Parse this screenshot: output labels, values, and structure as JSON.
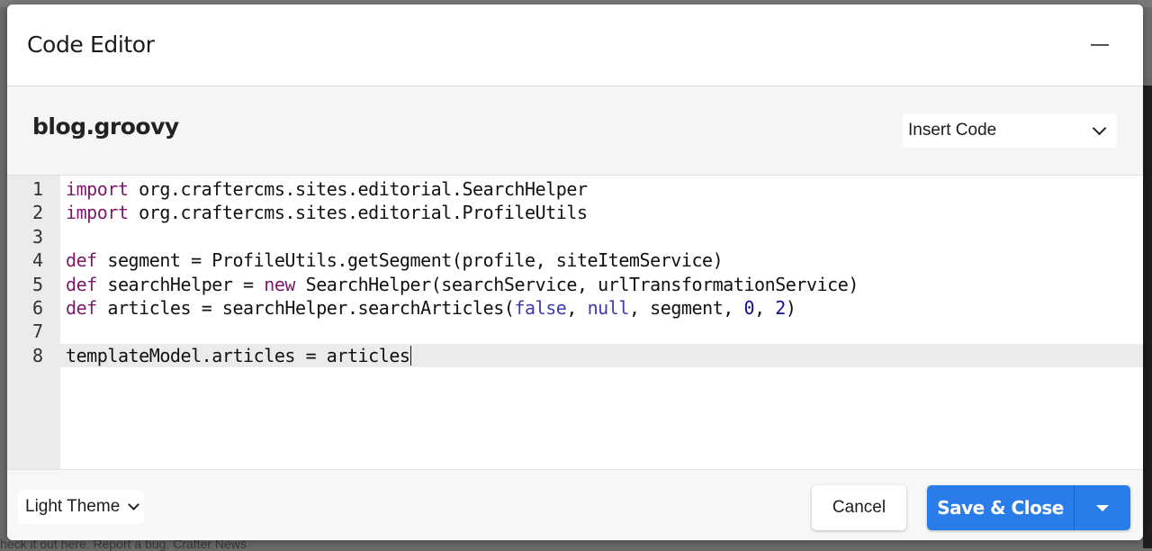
{
  "dialog": {
    "title": "Code Editor",
    "minimize_icon": "minimize-icon"
  },
  "subheader": {
    "file_name": "blog.groovy",
    "insert_code": {
      "selected": "Insert Code",
      "icon": "chevron-down-icon"
    }
  },
  "editor": {
    "language": "groovy",
    "active_line": 8,
    "lines": [
      {
        "number": "1",
        "tokens": [
          {
            "t": "import",
            "c": "kw"
          },
          {
            "t": " org.craftercms.sites.editorial.SearchHelper",
            "c": ""
          }
        ]
      },
      {
        "number": "2",
        "tokens": [
          {
            "t": "import",
            "c": "kw"
          },
          {
            "t": " org.craftercms.sites.editorial.ProfileUtils",
            "c": ""
          }
        ]
      },
      {
        "number": "3",
        "tokens": []
      },
      {
        "number": "4",
        "tokens": [
          {
            "t": "def",
            "c": "kw"
          },
          {
            "t": " segment = ProfileUtils.getSegment(profile, siteItemService)",
            "c": ""
          }
        ]
      },
      {
        "number": "5",
        "tokens": [
          {
            "t": "def",
            "c": "kw"
          },
          {
            "t": " searchHelper = ",
            "c": ""
          },
          {
            "t": "new",
            "c": "kw"
          },
          {
            "t": " SearchHelper(searchService, urlTransformationService)",
            "c": ""
          }
        ]
      },
      {
        "number": "6",
        "tokens": [
          {
            "t": "def",
            "c": "kw"
          },
          {
            "t": " articles = searchHelper.searchArticles(",
            "c": ""
          },
          {
            "t": "false",
            "c": "lit"
          },
          {
            "t": ", ",
            "c": ""
          },
          {
            "t": "null",
            "c": "lit"
          },
          {
            "t": ", segment, ",
            "c": ""
          },
          {
            "t": "0",
            "c": "num"
          },
          {
            "t": ", ",
            "c": ""
          },
          {
            "t": "2",
            "c": "num"
          },
          {
            "t": ")",
            "c": ""
          }
        ]
      },
      {
        "number": "7",
        "tokens": []
      },
      {
        "number": "8",
        "tokens": [
          {
            "t": "templateModel.articles = articles",
            "c": ""
          }
        ]
      }
    ]
  },
  "footer": {
    "theme_select": {
      "selected": "Light Theme",
      "icon": "chevron-down-icon"
    },
    "cancel_label": "Cancel",
    "save_label": "Save & Close",
    "save_menu_icon": "caret-down-icon"
  },
  "background": {
    "footer_links_text": "heck it out here. Report a bug. Crafter News"
  },
  "colors": {
    "primary": "#2a7de8",
    "keyword": "#7a1a6a",
    "literal": "#3a3db0",
    "number": "#11118c",
    "active_line": "#ebebeb"
  }
}
